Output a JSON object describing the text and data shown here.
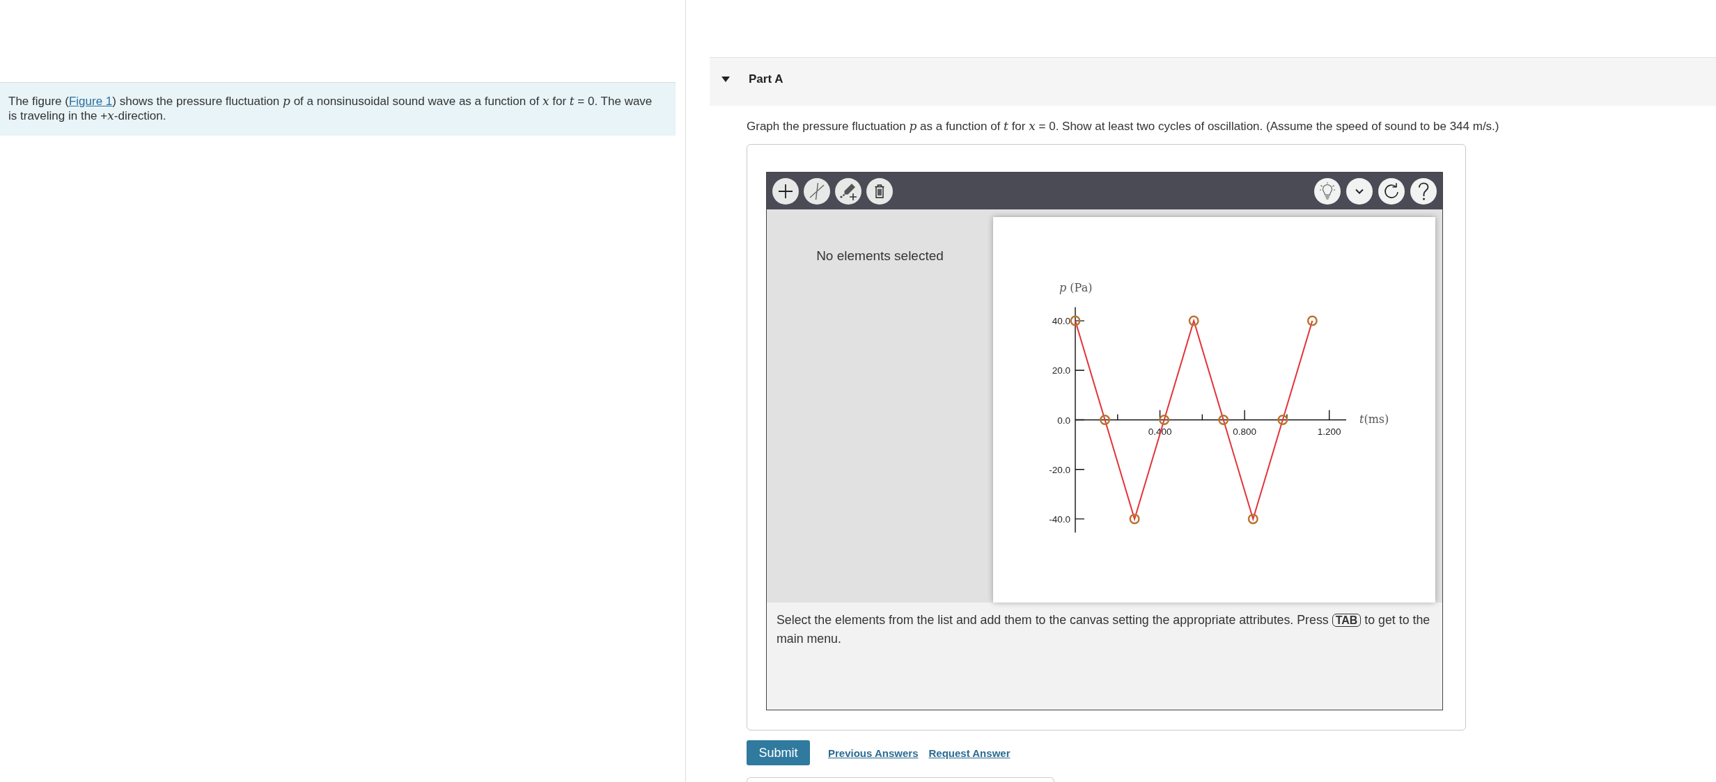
{
  "intro": {
    "before": "The figure (",
    "link": "Figure 1",
    "after": ") shows the pressure fluctuation *p* of a nonsinusoidal sound wave as a function of *x* for *t* = 0. The wave is traveling in the +*x*-direction."
  },
  "part": {
    "title": "Part A",
    "expanded": true
  },
  "question": "Graph the pressure fluctuation *p* as a function of *t* for *x* = 0. Show at least two cycles of oscillation. (Assume the speed of sound to be 344 m/s.)",
  "graph_tool": {
    "selection_text": "No elements selected",
    "chart_data": {
      "type": "line",
      "xlabel": "*t*(ms)",
      "ylabel": "*p* (Pa)",
      "x": [
        0,
        0.14,
        0.28,
        0.42,
        0.56,
        0.7,
        0.84,
        0.98,
        1.12
      ],
      "series": [
        {
          "color": "#e3323a",
          "marker": "circle",
          "values": [
            40,
            0,
            -40,
            0,
            40,
            0,
            -40,
            0,
            40
          ]
        }
      ],
      "xlim": [
        0,
        1.28
      ],
      "ylim": [
        -45.5,
        45.5
      ],
      "xticks": [
        {
          "value": 0.4,
          "label": "0.400"
        },
        {
          "value": 0.8,
          "label": "0.800"
        },
        {
          "value": 1.2,
          "label": "1.200"
        }
      ],
      "yticks": [
        {
          "value": -40,
          "label": "-40.0"
        },
        {
          "value": -20,
          "label": "-20.0"
        },
        {
          "value": 0,
          "label": "0.0"
        },
        {
          "value": 20,
          "label": "20.0"
        },
        {
          "value": 40,
          "label": "40.0"
        }
      ]
    },
    "instructions": {
      "before": "Select the elements from the list and add them to the canvas setting the appropriate attributes. Press",
      "key": "TAB",
      "after": "to get to the main menu."
    }
  },
  "actions": {
    "submit": "Submit",
    "links": [
      "Previous Answers",
      "Request Answer"
    ]
  }
}
